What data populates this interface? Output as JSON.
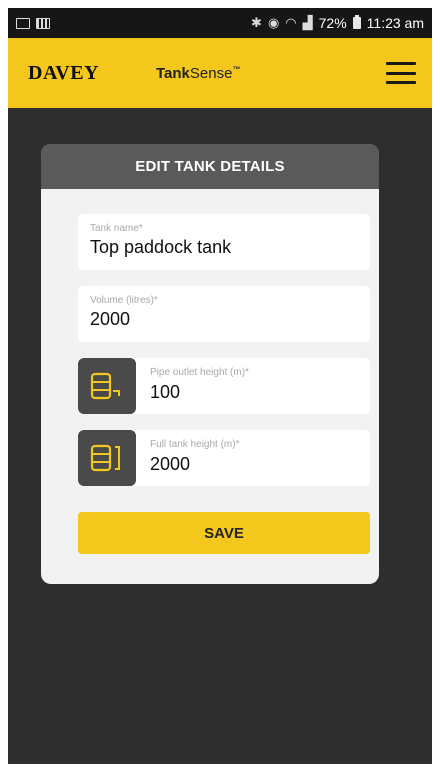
{
  "status_bar": {
    "battery_percent": "72%",
    "time": "11:23 am"
  },
  "header": {
    "brand": "DAVEY",
    "app_name_bold": "Tank",
    "app_name_thin": "Sense",
    "app_name_mark": "™"
  },
  "card": {
    "title": "EDIT TANK DETAILS",
    "fields": [
      {
        "label": "Tank name*",
        "value": "Top paddock tank"
      },
      {
        "label": "Volume (litres)*",
        "value": "2000"
      },
      {
        "label": "Pipe outlet height (m)*",
        "value": "100",
        "icon": "tank-outlet-icon"
      },
      {
        "label": "Full tank height (m)*",
        "value": "2000",
        "icon": "tank-height-icon"
      }
    ],
    "save_label": "SAVE"
  },
  "colors": {
    "accent": "#f3c71b",
    "background": "#2e2e2e",
    "card": "#f2f2f2",
    "card_header": "#5a5a5a"
  }
}
